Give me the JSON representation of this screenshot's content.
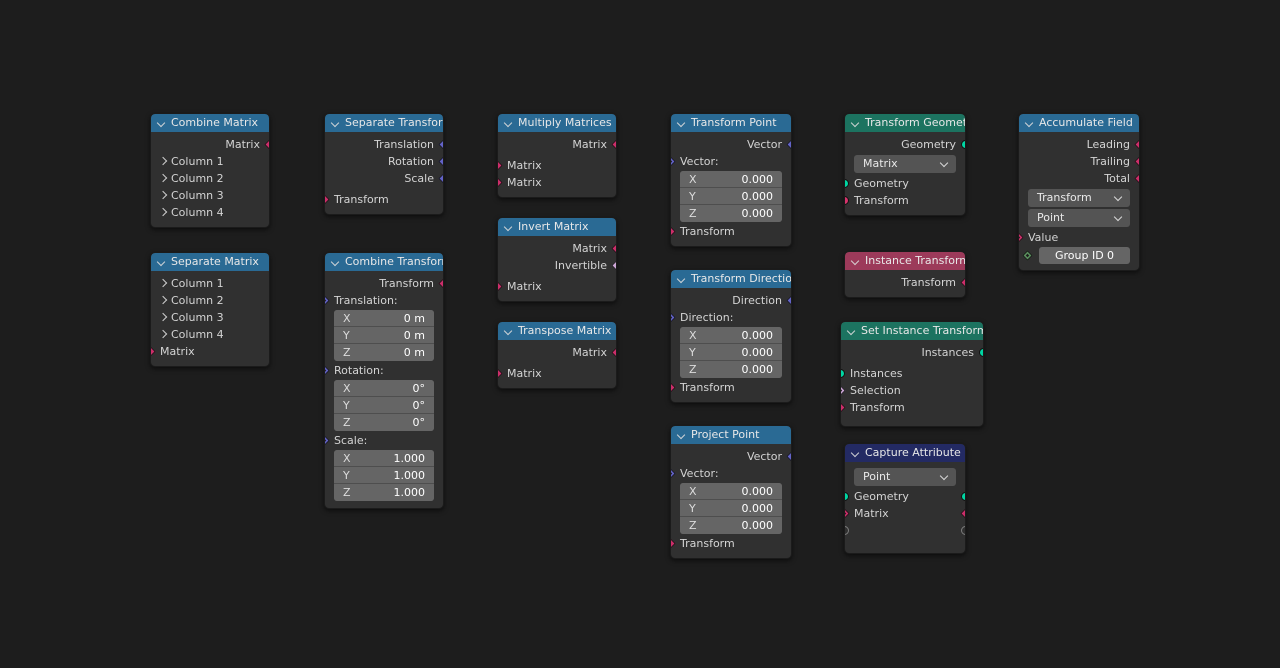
{
  "editor": {
    "name": "Geometry Node Editor",
    "background_color": "#1d1d1d"
  },
  "socket_colors": {
    "matrix": "#cc2e6a",
    "vector": "#6363c7",
    "geometry": "#00d6a3",
    "integer": "#598c5c",
    "float": "#a1a1a1",
    "boolean": "#cca6d6"
  },
  "header_colors": {
    "blue": "#2a6a94",
    "green": "#1c7360",
    "red": "#9c3a5a",
    "navy": "#232a63"
  },
  "nodes": {
    "combine_matrix": {
      "title": "Combine Matrix",
      "outputs": [
        {
          "label": "Matrix"
        }
      ],
      "panels": [
        {
          "label": "Column 1"
        },
        {
          "label": "Column 2"
        },
        {
          "label": "Column 3"
        },
        {
          "label": "Column 4"
        }
      ]
    },
    "separate_matrix": {
      "title": "Separate Matrix",
      "panels": [
        {
          "label": "Column 1"
        },
        {
          "label": "Column 2"
        },
        {
          "label": "Column 3"
        },
        {
          "label": "Column 4"
        }
      ],
      "inputs": [
        {
          "label": "Matrix"
        }
      ]
    },
    "separate_transform": {
      "title": "Separate Transform",
      "outputs": [
        {
          "label": "Translation"
        },
        {
          "label": "Rotation"
        },
        {
          "label": "Scale"
        }
      ],
      "inputs": [
        {
          "label": "Transform"
        }
      ]
    },
    "combine_transform": {
      "title": "Combine Transform",
      "outputs": [
        {
          "label": "Transform"
        }
      ],
      "translation": {
        "label": "Translation:",
        "fields": [
          {
            "axis": "X",
            "value": "0 m"
          },
          {
            "axis": "Y",
            "value": "0 m"
          },
          {
            "axis": "Z",
            "value": "0 m"
          }
        ]
      },
      "rotation": {
        "label": "Rotation:",
        "fields": [
          {
            "axis": "X",
            "value": "0°"
          },
          {
            "axis": "Y",
            "value": "0°"
          },
          {
            "axis": "Z",
            "value": "0°"
          }
        ]
      },
      "scale": {
        "label": "Scale:",
        "fields": [
          {
            "axis": "X",
            "value": "1.000"
          },
          {
            "axis": "Y",
            "value": "1.000"
          },
          {
            "axis": "Z",
            "value": "1.000"
          }
        ]
      }
    },
    "multiply_matrices": {
      "title": "Multiply Matrices",
      "outputs": [
        {
          "label": "Matrix"
        }
      ],
      "inputs": [
        {
          "label": "Matrix"
        },
        {
          "label": "Matrix"
        }
      ]
    },
    "invert_matrix": {
      "title": "Invert Matrix",
      "outputs": [
        {
          "label": "Matrix"
        },
        {
          "label": "Invertible"
        }
      ],
      "inputs": [
        {
          "label": "Matrix"
        }
      ]
    },
    "transpose_matrix": {
      "title": "Transpose Matrix",
      "outputs": [
        {
          "label": "Matrix"
        }
      ],
      "inputs": [
        {
          "label": "Matrix"
        }
      ]
    },
    "transform_point": {
      "title": "Transform Point",
      "outputs": [
        {
          "label": "Vector"
        }
      ],
      "vector": {
        "label": "Vector:",
        "fields": [
          {
            "axis": "X",
            "value": "0.000"
          },
          {
            "axis": "Y",
            "value": "0.000"
          },
          {
            "axis": "Z",
            "value": "0.000"
          }
        ]
      },
      "inputs": [
        {
          "label": "Transform"
        }
      ]
    },
    "transform_direction": {
      "title": "Transform Direction",
      "outputs": [
        {
          "label": "Direction"
        }
      ],
      "direction": {
        "label": "Direction:",
        "fields": [
          {
            "axis": "X",
            "value": "0.000"
          },
          {
            "axis": "Y",
            "value": "0.000"
          },
          {
            "axis": "Z",
            "value": "0.000"
          }
        ]
      },
      "inputs": [
        {
          "label": "Transform"
        }
      ]
    },
    "project_point": {
      "title": "Project Point",
      "outputs": [
        {
          "label": "Vector"
        }
      ],
      "vector": {
        "label": "Vector:",
        "fields": [
          {
            "axis": "X",
            "value": "0.000"
          },
          {
            "axis": "Y",
            "value": "0.000"
          },
          {
            "axis": "Z",
            "value": "0.000"
          }
        ]
      },
      "inputs": [
        {
          "label": "Transform"
        }
      ]
    },
    "transform_geometry": {
      "title": "Transform Geometry",
      "outputs": [
        {
          "label": "Geometry"
        }
      ],
      "mode_dropdown": "Matrix",
      "inputs": [
        {
          "label": "Geometry"
        },
        {
          "label": "Transform"
        }
      ]
    },
    "instance_transform": {
      "title": "Instance Transform",
      "outputs": [
        {
          "label": "Transform"
        }
      ]
    },
    "set_instance_transform": {
      "title": "Set Instance Transform",
      "outputs": [
        {
          "label": "Instances"
        }
      ],
      "inputs": [
        {
          "label": "Instances"
        },
        {
          "label": "Selection"
        },
        {
          "label": "Transform"
        }
      ]
    },
    "capture_attribute": {
      "title": "Capture Attribute",
      "domain_dropdown": "Point",
      "rows": [
        {
          "label": "Geometry"
        },
        {
          "label": "Matrix"
        }
      ]
    },
    "accumulate_field": {
      "title": "Accumulate Field",
      "outputs": [
        {
          "label": "Leading"
        },
        {
          "label": "Trailing"
        },
        {
          "label": "Total"
        }
      ],
      "data_type_dropdown": "Transform",
      "domain_dropdown": "Point",
      "inputs": [
        {
          "label": "Value"
        }
      ],
      "group_id": {
        "label": "Group ID",
        "value": "0"
      }
    }
  }
}
